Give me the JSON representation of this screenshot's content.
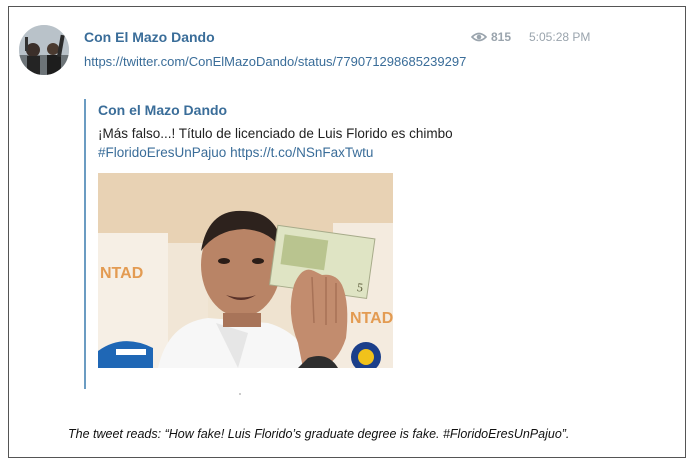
{
  "message": {
    "channel_name": "Con El Mazo Dando",
    "views": "815",
    "time": "5:05:28 PM",
    "link": "https://twitter.com/ConElMazoDando/status/779071298685239297"
  },
  "quote": {
    "author": "Con el Mazo Dando",
    "text": "¡Más falso...! Título de licenciado de Luis Florido es chimbo",
    "hashtag": "#FloridoEresUnPajuo",
    "short_link": "https://t.co/NSnFaxTwtu"
  },
  "photo": {
    "banner_text_left": "NTAD",
    "banner_text_right": "NTAD",
    "banknote_value": "5"
  },
  "caption": "The tweet reads: “How fake! Luis Florido’s graduate degree is fake. #FloridoEresUnPajuo”.",
  "icons": {
    "views": "eye-icon"
  }
}
